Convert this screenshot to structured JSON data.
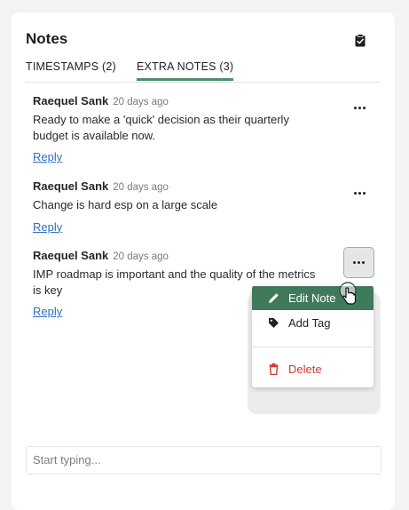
{
  "panel": {
    "title": "Notes",
    "clipboard_icon": "clipboard-check-icon"
  },
  "tabs": [
    {
      "label": "TIMESTAMPS (2)",
      "active": false
    },
    {
      "label": "EXTRA NOTES (3)",
      "active": true
    }
  ],
  "accent_color": "#4f8e6a",
  "notes": [
    {
      "author": "Raequel Sank",
      "time": "20 days ago",
      "text": "Ready to make a 'quick' decision as their quarterly budget is available now.",
      "reply_label": "Reply"
    },
    {
      "author": "Raequel Sank",
      "time": "20 days ago",
      "text": "Change is hard esp on a large scale",
      "reply_label": "Reply"
    },
    {
      "author": "Raequel Sank",
      "time": "20 days ago",
      "text": "IMP roadmap is important and the quality of the metrics is key",
      "reply_label": "Reply"
    }
  ],
  "context_menu": {
    "items": [
      {
        "label": "Edit Note",
        "icon": "pencil-icon",
        "highlighted": true
      },
      {
        "label": "Add Tag",
        "icon": "tag-icon",
        "highlighted": false
      },
      {
        "label": "Delete",
        "icon": "trash-icon",
        "highlighted": false,
        "color": "#d23a2a"
      }
    ]
  },
  "composer": {
    "placeholder": "Start typing...",
    "value": ""
  }
}
